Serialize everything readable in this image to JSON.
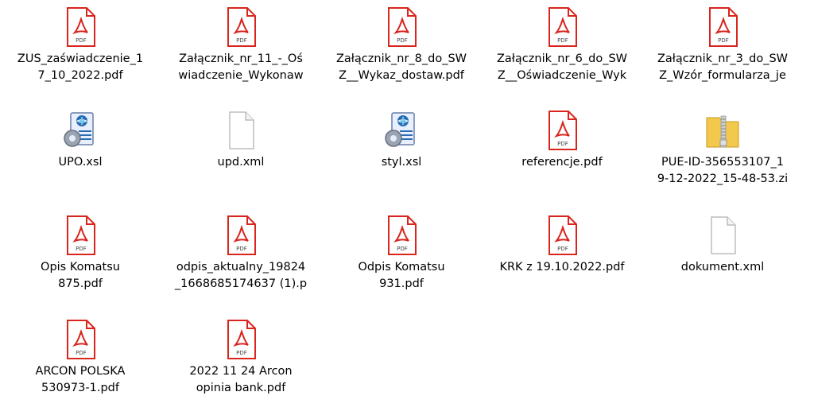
{
  "files": [
    {
      "line1": "ZUS_zaświadczenie_1",
      "line2": "7_10_2022.pdf",
      "icon": "pdf-icon"
    },
    {
      "line1": "Załącznik_nr_11_-_Oś",
      "line2": "wiadczenie_Wykonaw",
      "icon": "pdf-icon"
    },
    {
      "line1": "Załącznik_nr_8_do_SW",
      "line2": "Z__Wykaz_dostaw.pdf",
      "icon": "pdf-icon"
    },
    {
      "line1": "Załącznik_nr_6_do_SW",
      "line2": "Z__Oświadczenie_Wyk",
      "icon": "pdf-icon"
    },
    {
      "line1": "Załącznik_nr_3_do_SW",
      "line2": "Z_Wzór_formularza_je",
      "icon": "pdf-icon"
    },
    {
      "line1": "UPO.xsl",
      "line2": "",
      "icon": "xsl-icon"
    },
    {
      "line1": "upd.xml",
      "line2": "",
      "icon": "file-icon"
    },
    {
      "line1": "styl.xsl",
      "line2": "",
      "icon": "xsl-icon"
    },
    {
      "line1": "referencje.pdf",
      "line2": "",
      "icon": "pdf-icon"
    },
    {
      "line1": "PUE-ID-356553107_1",
      "line2": "9-12-2022_15-48-53.zi",
      "icon": "zip-icon"
    },
    {
      "line1": "Opis Komatsu",
      "line2": "875.pdf",
      "icon": "pdf-icon"
    },
    {
      "line1": "odpis_aktualny_19824",
      "line2": "_1668685174637 (1).p",
      "icon": "pdf-icon"
    },
    {
      "line1": "Odpis Komatsu",
      "line2": "931.pdf",
      "icon": "pdf-icon"
    },
    {
      "line1": "KRK z 19.10.2022.pdf",
      "line2": "",
      "icon": "pdf-icon"
    },
    {
      "line1": "dokument.xml",
      "line2": "",
      "icon": "file-icon"
    },
    {
      "line1": "ARCON POLSKA",
      "line2": "530973-1.pdf",
      "icon": "pdf-icon"
    },
    {
      "line1": "2022 11 24  Arcon",
      "line2": "opinia bank.pdf",
      "icon": "pdf-icon"
    }
  ],
  "colors": {
    "pdf_red": "#d9251d",
    "folder_yellow": "#f2c94c",
    "xsl_blue": "#2b6cb0"
  }
}
